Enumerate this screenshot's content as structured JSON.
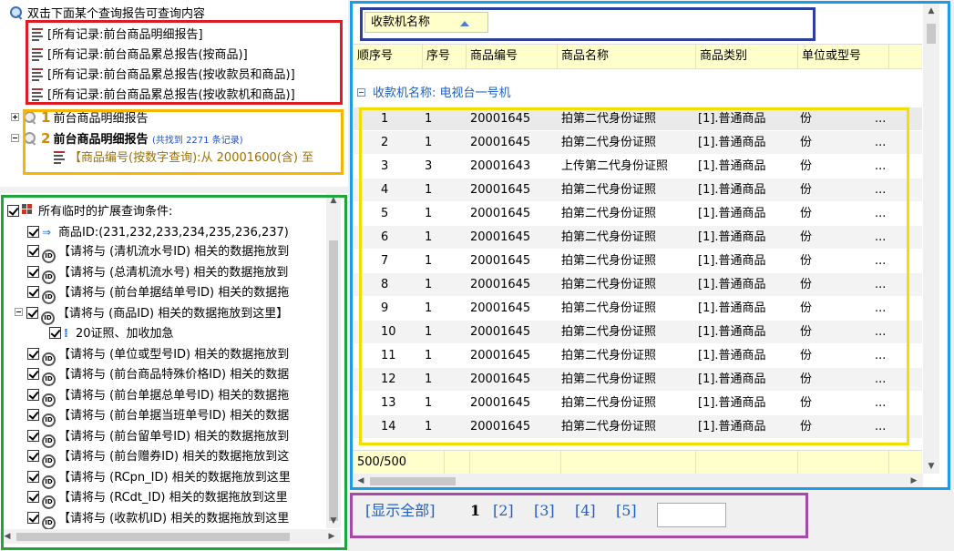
{
  "tree_top": {
    "root_label": "双击下面某个查询报告可查询内容",
    "records": [
      "[所有记录:前台商品明细报告]",
      "[所有记录:前台商品累总报告(按商品)]",
      "[所有记录:前台商品累总报告(按收款员和商品)]",
      "[所有记录:前台商品累总报告(按收款机和商品)]"
    ],
    "report1": {
      "num": "1",
      "label": "前台商品明细报告"
    },
    "report2": {
      "num": "2",
      "label": "前台商品明细报告",
      "found": "(共找到 2271 条记录)"
    },
    "condition": "【商品编号(按数字查询):从 20001600(含) 至"
  },
  "tree_bottom": {
    "root_label": "所有临时的扩展查询条件:",
    "product_id_line": "商品ID:(231,232,233,234,235,236,237)",
    "items": [
      "【请将与 (清机流水号ID) 相关的数据拖放到",
      "【请将与 (总清机流水号) 相关的数据拖放到",
      "【请将与 (前台单据结单号ID) 相关的数据拖",
      "【请将与 (商品ID) 相关的数据拖放到这里】",
      "【请将与 (单位或型号ID) 相关的数据拖放到",
      "【请将与 (前台商品特殊价格ID) 相关的数据",
      "【请将与 (前台单据总单号ID) 相关的数据拖",
      "【请将与 (前台单据当班单号ID) 相关的数据",
      "【请将与 (前台留单号ID) 相关的数据拖放到",
      "【请将与 (前台赠券ID) 相关的数据拖放到这",
      "【请将与 (RCpn_ID) 相关的数据拖放到这里",
      "【请将与 (RCdt_ID) 相关的数据拖放到这里",
      "【请将与 (收款机ID) 相关的数据拖放到这里"
    ],
    "sub_item": "20证照、加收加急"
  },
  "grid": {
    "group_chip": "收款机名称",
    "columns": [
      "顺序号",
      "序号",
      "商品编号",
      "商品名称",
      "商品类别",
      "单位或型号"
    ],
    "group_row": "收款机名称: 电视台一号机",
    "rows": [
      [
        "1",
        "1",
        "20001645",
        "拍第二代身份证照",
        "[1].普通商品",
        "份",
        "..."
      ],
      [
        "2",
        "1",
        "20001645",
        "拍第二代身份证照",
        "[1].普通商品",
        "份",
        "..."
      ],
      [
        "3",
        "3",
        "20001643",
        "上传第二代身份证照",
        "[1].普通商品",
        "份",
        "..."
      ],
      [
        "4",
        "1",
        "20001645",
        "拍第二代身份证照",
        "[1].普通商品",
        "份",
        "..."
      ],
      [
        "5",
        "1",
        "20001645",
        "拍第二代身份证照",
        "[1].普通商品",
        "份",
        "..."
      ],
      [
        "6",
        "1",
        "20001645",
        "拍第二代身份证照",
        "[1].普通商品",
        "份",
        "..."
      ],
      [
        "7",
        "1",
        "20001645",
        "拍第二代身份证照",
        "[1].普通商品",
        "份",
        "..."
      ],
      [
        "8",
        "1",
        "20001645",
        "拍第二代身份证照",
        "[1].普通商品",
        "份",
        "..."
      ],
      [
        "9",
        "1",
        "20001645",
        "拍第二代身份证照",
        "[1].普通商品",
        "份",
        "..."
      ],
      [
        "10",
        "1",
        "20001645",
        "拍第二代身份证照",
        "[1].普通商品",
        "份",
        "..."
      ],
      [
        "11",
        "1",
        "20001645",
        "拍第二代身份证照",
        "[1].普通商品",
        "份",
        "..."
      ],
      [
        "12",
        "1",
        "20001645",
        "拍第二代身份证照",
        "[1].普通商品",
        "份",
        "..."
      ],
      [
        "13",
        "1",
        "20001645",
        "拍第二代身份证照",
        "[1].普通商品",
        "份",
        "..."
      ],
      [
        "14",
        "1",
        "20001645",
        "拍第二代身份证照",
        "[1].普通商品",
        "份",
        "..."
      ]
    ],
    "footer": "500/500"
  },
  "pager": {
    "show_all": "[显示全部]",
    "current": "1",
    "pages": [
      "[2]",
      "[3]",
      "[4]",
      "[5]"
    ],
    "input_value": ""
  },
  "colors": {
    "red": "#e01b24",
    "orange": "#f7b500",
    "green": "#1fa53a",
    "cyan": "#1e9be6",
    "navy": "#2d3f9c",
    "yellow": "#f3de00",
    "purple": "#a44ba8",
    "link_blue": "#1f5fbf",
    "header_yellow": "#ffffcc"
  }
}
